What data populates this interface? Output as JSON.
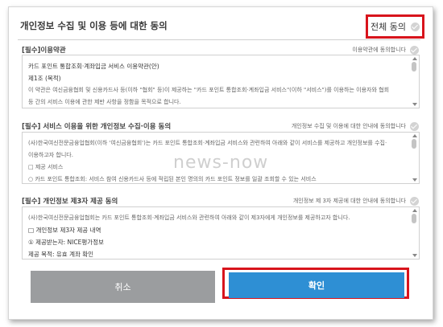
{
  "header": {
    "title": "개인정보 수집 및 이용 등에 대한 동의",
    "agree_all_label": "전체 동의"
  },
  "sections": [
    {
      "title": "[필수]이용약관",
      "agree_label": "이용약관에 동의합니다",
      "lines": [
        "카드 포인트 통합조회·계좌입금 서비스 이용약관(안)",
        "제1조 (목적)",
        "이 약관은 여신금융협회 및 신용카드사 등(이하 \"협회\" 등)이 제공하는 \"카드 포인트 통합조회·계좌입금 서비스\"(이하 \"서비스\")를 이용하는 이용자와 협회",
        "등 간의 서비스 이용에 관한 제반 사항을 정함을 목적으로 합니다."
      ]
    },
    {
      "title": "[필수] 서비스 이용을 위한 개인정보 수집·이용 동의",
      "agree_label": "개인정보 수집 및 이용에 대한 안내에 동의합니다",
      "lines": [
        "(사)한국여신전문금융업협회(이하 '여신금융협회')는 카드 포인트 통합조회·계좌입금 서비스와 관련하여 아래와 같이 서비스를 제공하고 개인정보를 수집·",
        "이용하고자 합니다.",
        "□ 제공 서비스",
        "○ 카드 포인트 통합조회: 서비스 참여 신용카드사 등에 적립된 본인 명의의 카드 포인트 정보를 일괄 조회할 수 있는 서비스"
      ]
    },
    {
      "title": "[필수] 개인정보 제3자 제공 동의",
      "agree_label": "개인정보 제 3자 제공에 대한 안내에 동의합니다",
      "lines": [
        "(사)한국여신전문금융업협회는 카드 포인트 통합조회·계좌입금 서비스와 관련하여 아래와 같이 제3자에게 개인정보를 제공하고자 합니다.",
        "□ 개인정보 제3자 제공 내역",
        "① 제공받는자: NICE평가정보",
        "제공 목적: 유효 계좌 확인"
      ]
    }
  ],
  "watermark": "news-now",
  "buttons": {
    "cancel_label": "취소",
    "confirm_label": "확인"
  },
  "colors": {
    "highlight_red": "#d8141c",
    "confirm_blue": "#2e8fd4",
    "cancel_gray": "#9b9d9f"
  }
}
